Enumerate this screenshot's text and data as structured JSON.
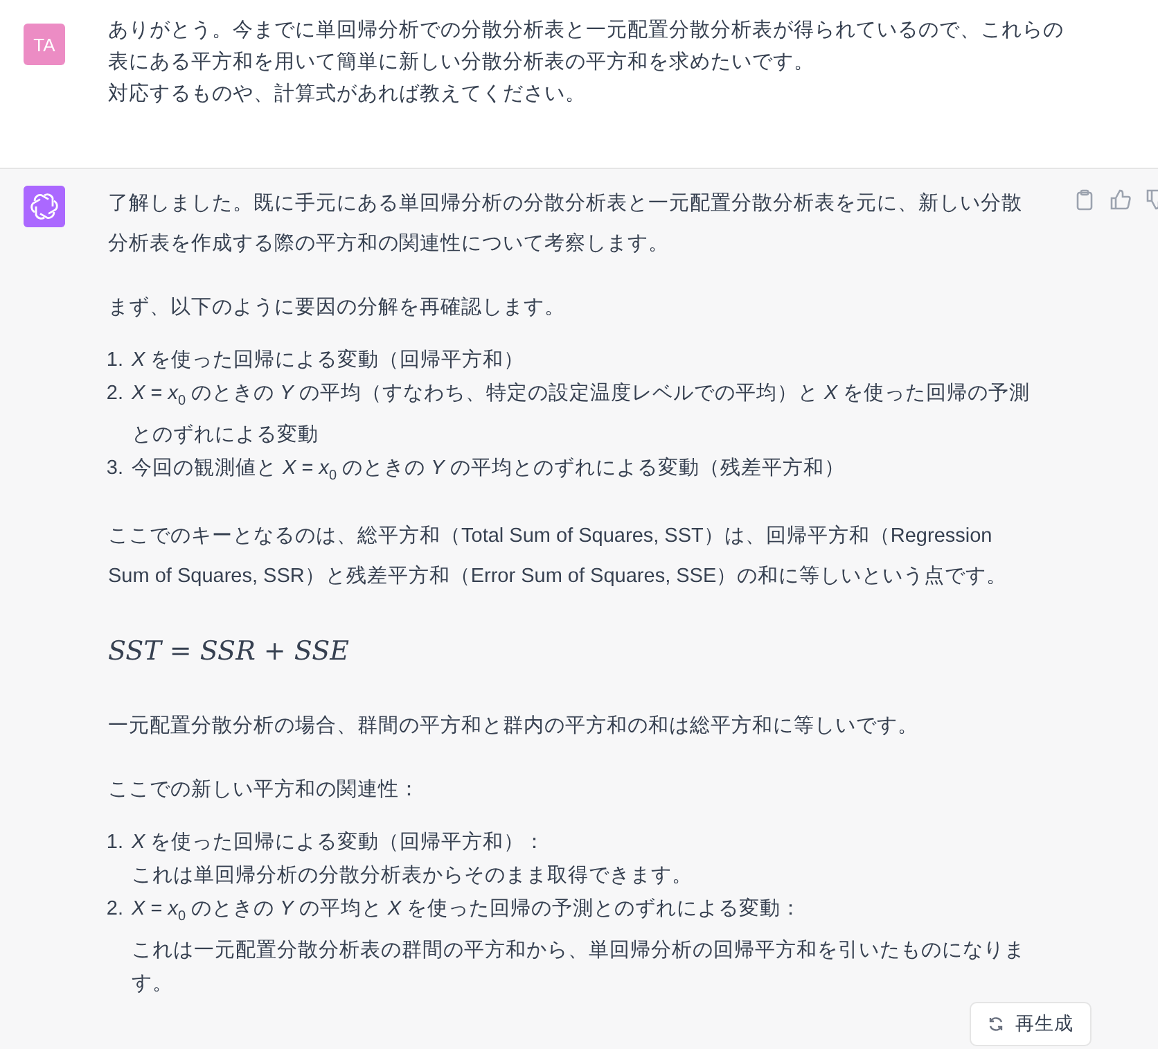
{
  "user_message": {
    "avatar": "TA",
    "lines": [
      "ありがとう。今までに単回帰分析での分散分析表と一元配置分散分析表が得られているので、これらの",
      "表にある平方和を用いて簡単に新しい分散分析表の平方和を求めたいです。",
      "対応するものや、計算式があれば教えてください。"
    ]
  },
  "assistant_message": {
    "blocks": [
      {
        "kind": "paragraph",
        "lines": [
          "了解しました。既に手元にある単回帰分析の分散分析表と一元配置分散分析表を元に、新しい分散",
          "分析表を作成する際の平方和の関連性について考察します。"
        ]
      },
      {
        "kind": "paragraph",
        "lines": [
          "まず、以下のように要因の分解を再確認します。"
        ]
      },
      {
        "kind": "list",
        "items": [
          {
            "number": "1.",
            "lines": [
              "*X* を使った回帰による変動（回帰平方和）"
            ]
          },
          {
            "number": "2.",
            "lines": [
              "*X* = *x*$_{0}$ のときの *Y* の平均（すなわち、特定の設定温度レベルでの平均）と *X* を使った回帰の予測",
              "とのずれによる変動"
            ]
          },
          {
            "number": "3.",
            "lines": [
              "今回の観測値と *X* = *x*$_{0}$ のときの *Y* の平均とのずれによる変動（残差平方和）"
            ]
          }
        ]
      },
      {
        "kind": "paragraph",
        "lines": [
          "ここでのキーとなるのは、総平方和（Total Sum of Squares, SST）は、回帰平方和（Regression",
          "Sum of Squares, SSR）と残差平方和（Error Sum of Squares, SSE）の和に等しいという点です。"
        ]
      },
      {
        "kind": "formula",
        "lines": [
          "*SST* = *SSR* + *SSE*"
        ]
      },
      {
        "kind": "paragraph",
        "lines": [
          "一元配置分散分析の場合、群間の平方和と群内の平方和の和は総平方和に等しいです。"
        ]
      },
      {
        "kind": "paragraph",
        "lines": [
          "ここでの新しい平方和の関連性："
        ]
      },
      {
        "kind": "list",
        "items": [
          {
            "number": "1.",
            "lines": [
              "*X* を使った回帰による変動（回帰平方和）：",
              "これは単回帰分析の分散分析表からそのまま取得できます。"
            ]
          },
          {
            "number": "2.",
            "lines": [
              "*X* = *x*$_{0}$ のときの *Y* の平均と *X* を使った回帰の予測とのずれによる変動：",
              "これは一元配置分散分析表の群間の平方和から、単回帰分析の回帰平方和を引いたものになりま",
              "す。"
            ]
          }
        ]
      }
    ]
  },
  "regenerate_button": {
    "label": "再生成"
  }
}
